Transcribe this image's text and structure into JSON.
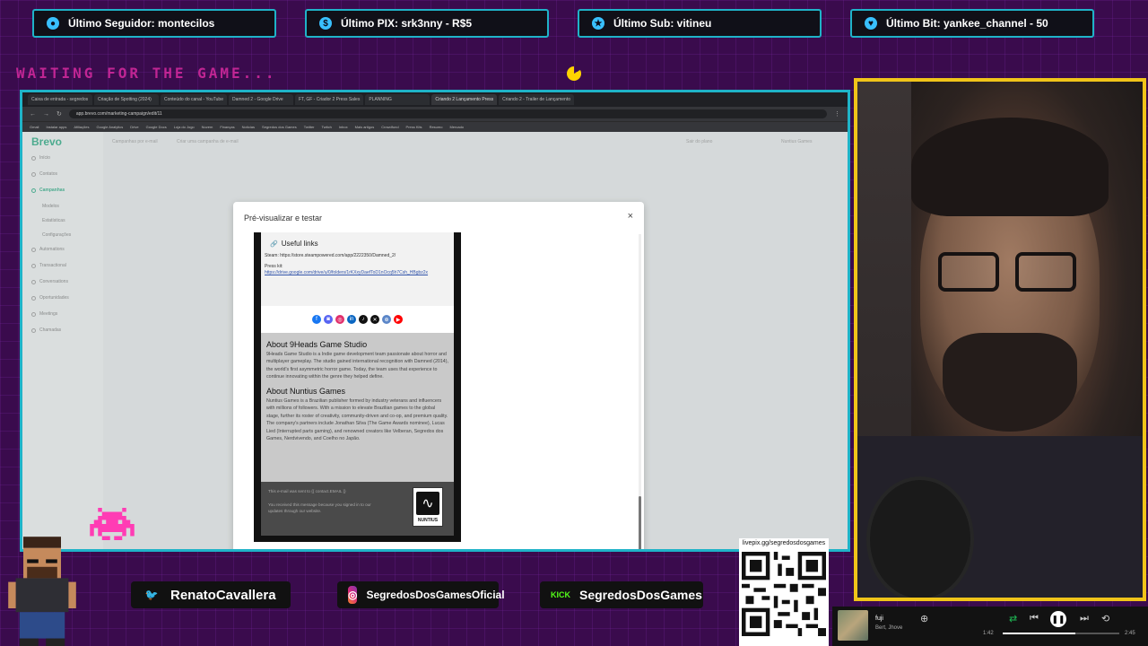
{
  "stream": {
    "top_bar": [
      {
        "label": "Último Seguidor: montecilos",
        "icon": "user-icon"
      },
      {
        "label": "Último PIX: srk3nny - R$5",
        "icon": "dollar-icon"
      },
      {
        "label": "Último Sub: vitineu",
        "icon": "star-icon"
      },
      {
        "label": "Último Bit: yankee_channel - 50",
        "icon": "heart-icon"
      }
    ],
    "waiting_text": "WAITING FOR THE GAME...",
    "socials": [
      {
        "label": "RenatoCavallera",
        "icon": "twitter-icon",
        "glyph": "🐦"
      },
      {
        "label": "SegredosDosGamesOficial",
        "icon": "instagram-icon",
        "glyph": "◎"
      },
      {
        "label": "SegredosDosGames",
        "icon": "kick-icon",
        "glyph": "KICK"
      }
    ],
    "qr_label": "livepix.gg/segredosdosgames"
  },
  "browser": {
    "tabs": [
      "Caixa de entrada - segredos",
      "Criação de Spotting (2024)",
      "Conteúdo do canal - YouTube",
      "Damned 2 - Google Drive",
      "FT, GF - Criador 2 Press Sales",
      "PLANNING",
      "Criando 2 Lançamento Press",
      "Criando 2 - Trailer de Lançamento"
    ],
    "active_tab_index": 6,
    "url": "app.brevo.com/marketing-campaign/edit/11",
    "bookmarks": [
      "Gmail",
      "Instalar apps",
      "Afiliações",
      "Google Analytics",
      "Drive",
      "Google Docs",
      "Loja do Jogo",
      "Nuvem",
      "Finanças",
      "Notícias",
      "Segredos dos Games",
      "Twitter",
      "Twitch",
      "Inbox",
      "Mais artigos",
      "Crowdfund",
      "Press Kits",
      "Resumo",
      "Mercado"
    ]
  },
  "app": {
    "logo": "Brevo",
    "breadcrumb": "Campanhas por e-mail",
    "page_heading": "Criar uma campanha de e-mail",
    "top_right": [
      "Sair do plano",
      "Nuntius Games"
    ],
    "sidebar": [
      {
        "label": "Início",
        "active": false
      },
      {
        "label": "Contatos",
        "active": false
      },
      {
        "label": "Campanhas",
        "active": true
      },
      {
        "label": "Modelos",
        "active": false,
        "sub": true
      },
      {
        "label": "Estatísticas",
        "active": false,
        "sub": true
      },
      {
        "label": "Configurações",
        "active": false,
        "sub": true
      },
      {
        "label": "Automations",
        "active": false
      },
      {
        "label": "Transactional",
        "active": false
      },
      {
        "label": "Conversations",
        "active": false
      },
      {
        "label": "Oportunidades",
        "active": false
      },
      {
        "label": "Meetings",
        "active": false
      },
      {
        "label": "Chamadas",
        "active": false
      }
    ]
  },
  "modal": {
    "title": "Pré-visualizar e testar",
    "close": "×",
    "email": {
      "useful_links_title": "Useful links",
      "steam_line": "Steam: https://store.steampowered.com/app/2222350/Damned_2/",
      "press_kit_label": "Press kit:",
      "press_kit_link": "https://drive.google.com/drive/u/0/folders/1rKXxyDaefToD1nOcq5h7Csh_HBgbz2x",
      "social_icons": [
        {
          "name": "facebook-icon",
          "color": "#1877f2",
          "glyph": "f"
        },
        {
          "name": "discord-icon",
          "color": "#5865f2",
          "glyph": "◙"
        },
        {
          "name": "instagram-icon",
          "color": "#e1306c",
          "glyph": "◎"
        },
        {
          "name": "linkedin-icon",
          "color": "#0a66c2",
          "glyph": "in"
        },
        {
          "name": "tiktok-icon",
          "color": "#111111",
          "glyph": "♪"
        },
        {
          "name": "x-icon",
          "color": "#111111",
          "glyph": "✕"
        },
        {
          "name": "website-icon",
          "color": "#5b86c8",
          "glyph": "⊕"
        },
        {
          "name": "youtube-icon",
          "color": "#ff0000",
          "glyph": "▶"
        }
      ],
      "about1_title": "About 9Heads Game Studio",
      "about1_body": "9Heads Game Studio is a Indie game development team passionate about horror and multiplayer gameplay. The studio gained international recognition with Damned (2014), the world's first asymmetric horror game. Today, the team uses that experience to continue innovating within the genre they helped define.",
      "about2_title": "About Nuntius Games",
      "about2_body": "Nuntius Games is a Brazilian publisher formed by industry veterans and influencers with millions of followers. With a mission to elevate Brazilian games to the global stage, further its roster of creativity, community-driven and co-op, and premium quality. The company's partners include Jonathan Silva (The Game Awards nominee), Lucas Lied (Interrupted parts gaming), and renowned creators like Velberan, Segredos dos Games, Nerdvivendo, and Coelho no Japão.",
      "footer_line1": "This e-mail was sent to {{ contact.EMAIL }}",
      "footer_line2": "You received this message because you signed in to our updates through our website.",
      "logo_text": "NUNTIUS"
    }
  },
  "player": {
    "track": "fuji",
    "artist": "Bert, Jhove",
    "elapsed": "1:42",
    "total": "2:45",
    "progress": 0.62
  }
}
